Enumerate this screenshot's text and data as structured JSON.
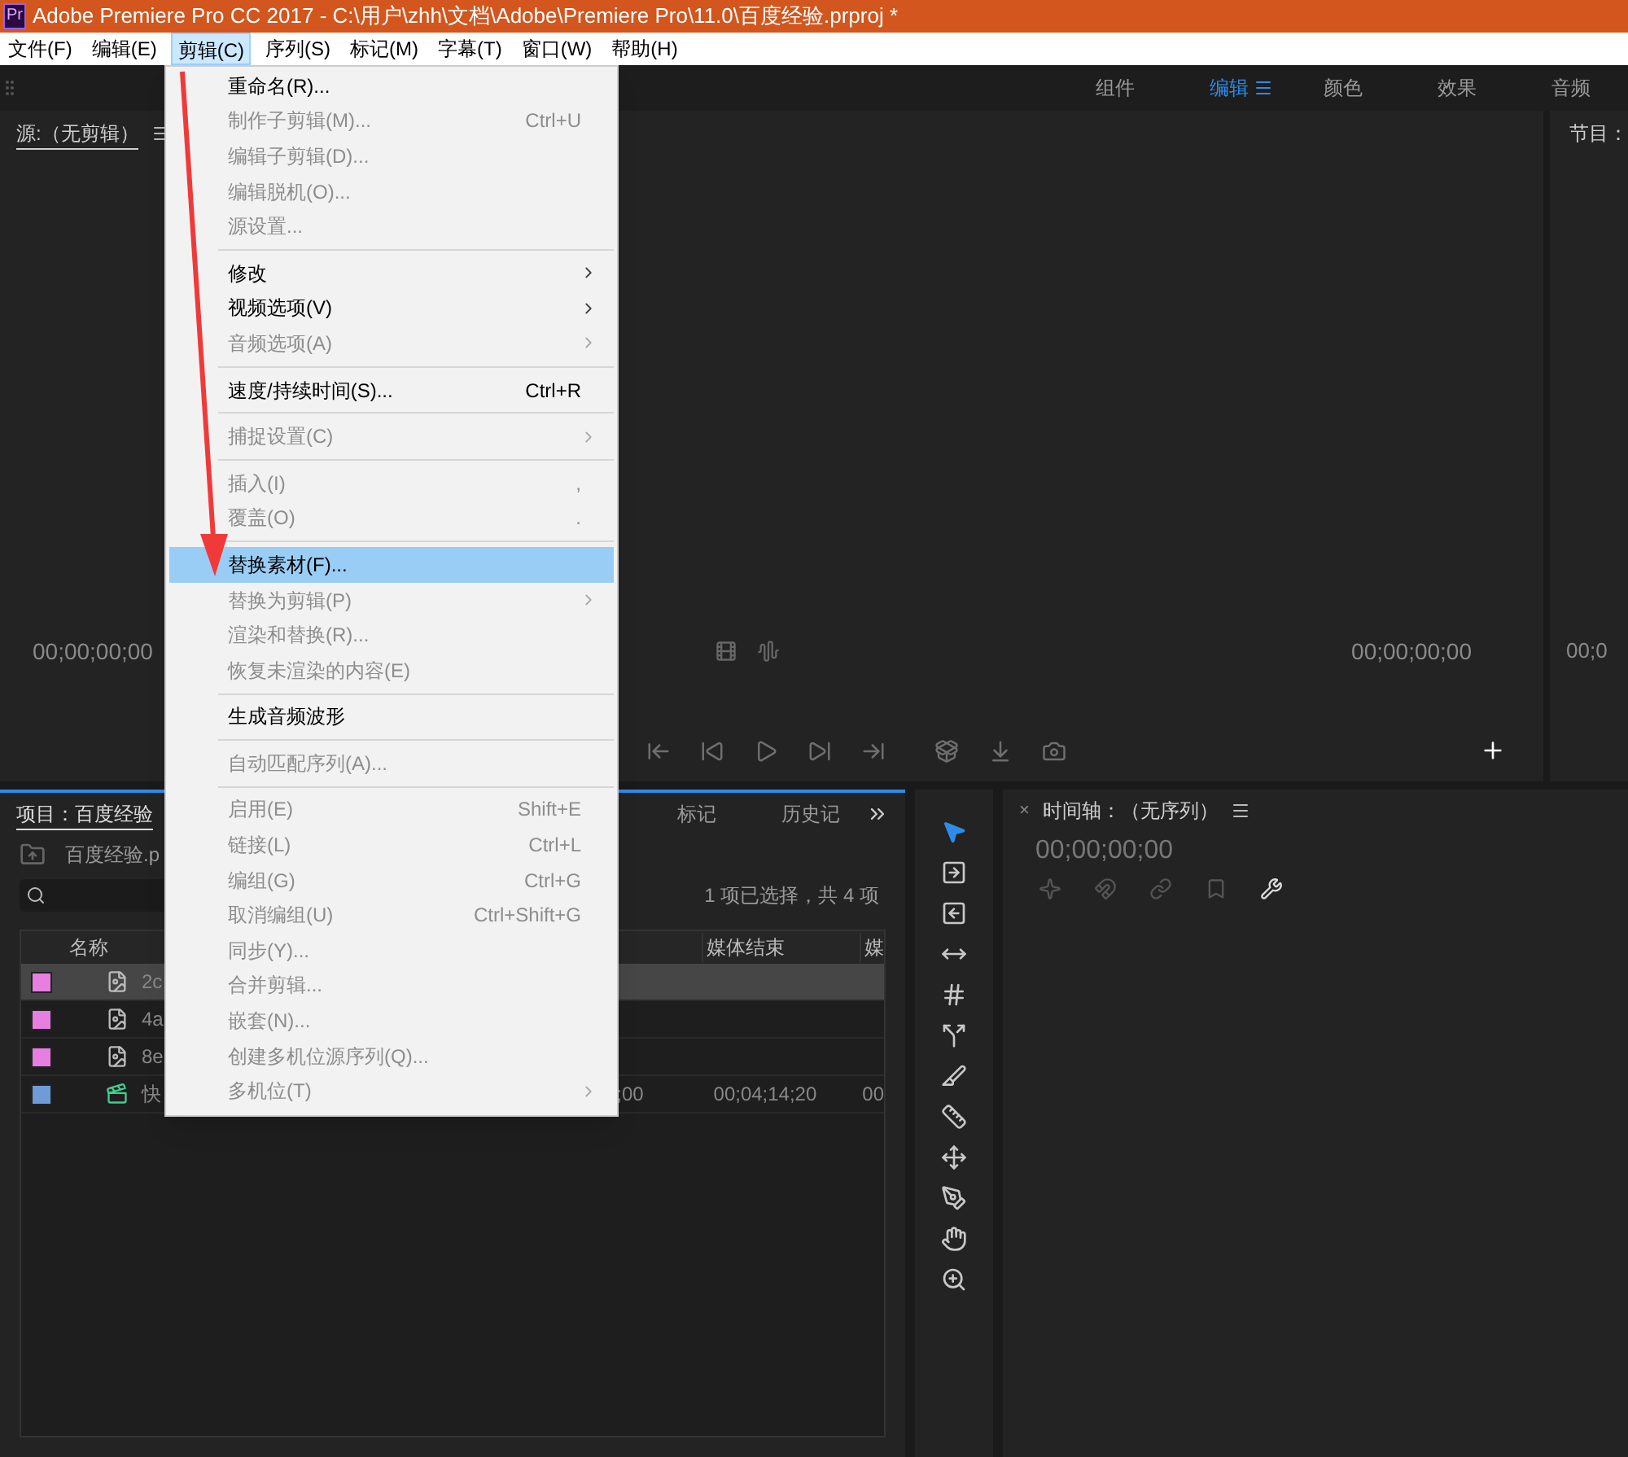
{
  "title_bar": {
    "app_icon": "Pr",
    "title": "Adobe Premiere Pro CC 2017 - C:\\用户\\zhh\\文档\\Adobe\\Premiere Pro\\11.0\\百度经验.prproj *"
  },
  "menu_bar": [
    {
      "label": "文件(F)",
      "selected": false
    },
    {
      "label": "编辑(E)",
      "selected": false
    },
    {
      "label": "剪辑(C)",
      "selected": true
    },
    {
      "label": "序列(S)",
      "selected": false
    },
    {
      "label": "标记(M)",
      "selected": false
    },
    {
      "label": "字幕(T)",
      "selected": false
    },
    {
      "label": "窗口(W)",
      "selected": false
    },
    {
      "label": "帮助(H)",
      "selected": false
    }
  ],
  "workspaces": [
    {
      "label": "组件",
      "selected": false
    },
    {
      "label": "编辑",
      "selected": true
    },
    {
      "label": "颜色",
      "selected": false
    },
    {
      "label": "效果",
      "selected": false
    },
    {
      "label": "音频",
      "selected": false
    }
  ],
  "source_monitor": {
    "tab": "源:（无剪辑）",
    "timecode_left": "00;00;00;00",
    "timecode_right": "00;00;00;00"
  },
  "program_monitor": {
    "tab": "节目：",
    "timecode": "00;0"
  },
  "clip_menu": [
    {
      "kind": "item",
      "label": "重命名(R)...",
      "disabled": false,
      "selected": false,
      "submenu": false
    },
    {
      "kind": "item",
      "label": "制作子剪辑(M)...",
      "shortcut": "Ctrl+U",
      "disabled": true,
      "selected": false,
      "submenu": false
    },
    {
      "kind": "item",
      "label": "编辑子剪辑(D)...",
      "disabled": true,
      "selected": false,
      "submenu": false
    },
    {
      "kind": "item",
      "label": "编辑脱机(O)...",
      "disabled": true,
      "selected": false,
      "submenu": false
    },
    {
      "kind": "item",
      "label": "源设置...",
      "disabled": true,
      "selected": false,
      "submenu": false
    },
    {
      "kind": "separator"
    },
    {
      "kind": "item",
      "label": "修改",
      "disabled": false,
      "selected": false,
      "submenu": true
    },
    {
      "kind": "item",
      "label": "视频选项(V)",
      "disabled": false,
      "selected": false,
      "submenu": true
    },
    {
      "kind": "item",
      "label": "音频选项(A)",
      "disabled": true,
      "selected": false,
      "submenu": true
    },
    {
      "kind": "separator"
    },
    {
      "kind": "item",
      "label": "速度/持续时间(S)...",
      "shortcut": "Ctrl+R",
      "disabled": false,
      "selected": false,
      "submenu": false
    },
    {
      "kind": "separator"
    },
    {
      "kind": "item",
      "label": "捕捉设置(C)",
      "disabled": true,
      "selected": false,
      "submenu": true
    },
    {
      "kind": "separator"
    },
    {
      "kind": "item",
      "label": "插入(I)",
      "shortcut": ",",
      "disabled": true,
      "selected": false,
      "submenu": false
    },
    {
      "kind": "item",
      "label": "覆盖(O)",
      "shortcut": ".",
      "disabled": true,
      "selected": false,
      "submenu": false
    },
    {
      "kind": "separator"
    },
    {
      "kind": "item",
      "label": "替换素材(F)...",
      "disabled": false,
      "selected": true,
      "submenu": false
    },
    {
      "kind": "item",
      "label": "替换为剪辑(P)",
      "disabled": true,
      "selected": false,
      "submenu": true
    },
    {
      "kind": "item",
      "label": "渲染和替换(R)...",
      "disabled": true,
      "selected": false,
      "submenu": false
    },
    {
      "kind": "item",
      "label": "恢复未渲染的内容(E)",
      "disabled": true,
      "selected": false,
      "submenu": false
    },
    {
      "kind": "separator"
    },
    {
      "kind": "item",
      "label": "生成音频波形",
      "disabled": false,
      "selected": false,
      "submenu": false
    },
    {
      "kind": "separator"
    },
    {
      "kind": "item",
      "label": "自动匹配序列(A)...",
      "disabled": true,
      "selected": false,
      "submenu": false
    },
    {
      "kind": "separator"
    },
    {
      "kind": "item",
      "label": "启用(E)",
      "shortcut": "Shift+E",
      "disabled": true,
      "selected": false,
      "submenu": false
    },
    {
      "kind": "item",
      "label": "链接(L)",
      "shortcut": "Ctrl+L",
      "disabled": true,
      "selected": false,
      "submenu": false
    },
    {
      "kind": "item",
      "label": "编组(G)",
      "shortcut": "Ctrl+G",
      "disabled": true,
      "selected": false,
      "submenu": false
    },
    {
      "kind": "item",
      "label": "取消编组(U)",
      "shortcut": "Ctrl+Shift+G",
      "disabled": true,
      "selected": false,
      "submenu": false
    },
    {
      "kind": "item",
      "label": "同步(Y)...",
      "disabled": true,
      "selected": false,
      "submenu": false
    },
    {
      "kind": "item",
      "label": "合并剪辑...",
      "disabled": true,
      "selected": false,
      "submenu": false
    },
    {
      "kind": "item",
      "label": "嵌套(N)...",
      "disabled": true,
      "selected": false,
      "submenu": false
    },
    {
      "kind": "item",
      "label": "创建多机位源序列(Q)...",
      "disabled": true,
      "selected": false,
      "submenu": false
    },
    {
      "kind": "item",
      "label": "多机位(T)",
      "disabled": true,
      "selected": false,
      "submenu": true
    }
  ],
  "project_panel": {
    "tabs": [
      {
        "label": "项目：百度经验",
        "selected": true
      },
      {
        "label": "标记",
        "selected": false
      },
      {
        "label": "历史记",
        "selected": false
      }
    ],
    "breadcrumb": "百度经验.p",
    "selection_info": "1 项已选择，共 4 项",
    "columns": [
      "名称",
      "媒体结束",
      "媒"
    ],
    "rows": [
      {
        "kind": "image",
        "color": "#e67fe0",
        "name": "2c",
        "selected": true
      },
      {
        "kind": "image",
        "color": "#e67fe0",
        "name": "4a",
        "selected": false
      },
      {
        "kind": "image",
        "color": "#e67fe0",
        "name": "8e",
        "selected": false
      },
      {
        "kind": "sequence",
        "color": "#6f9bd6",
        "name": "快",
        "column_3": ";00",
        "media_end": "00;04;14;20",
        "column_5": "00",
        "selected": false
      }
    ]
  },
  "tools": [
    {
      "selected": true
    },
    {
      "selected": false
    },
    {
      "selected": false
    },
    {
      "selected": false
    },
    {
      "selected": false
    },
    {
      "selected": false
    },
    {
      "selected": false
    },
    {
      "selected": false
    },
    {
      "selected": false
    },
    {
      "selected": false
    },
    {
      "selected": false
    },
    {
      "selected": false
    }
  ],
  "timeline": {
    "close": "×",
    "tab": "时间轴：（无序列）",
    "timecode": "00;00;00;00"
  }
}
